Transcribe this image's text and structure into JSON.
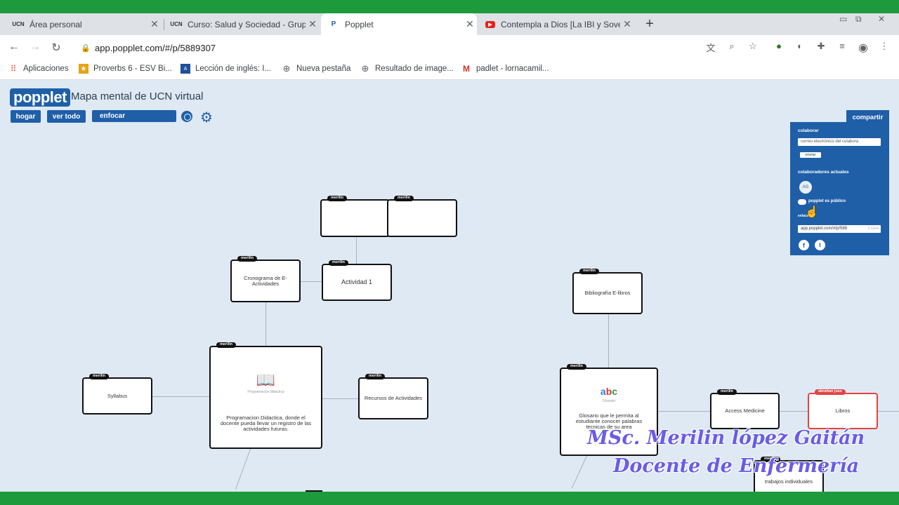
{
  "browser": {
    "tabs": [
      {
        "title": "Área personal",
        "favicon": "UCN"
      },
      {
        "title": "Curso: Salud y Sociedad - Grupo",
        "favicon": "UCN"
      },
      {
        "title": "Popplet",
        "favicon": "P"
      },
      {
        "title": "Contempla a Dios [La IBI y Soven",
        "favicon": "▶"
      }
    ],
    "url": "app.popplet.com/#/p/5889307",
    "bookmarks": [
      {
        "label": "Aplicaciones"
      },
      {
        "label": "Proverbs 6 - ESV Bi..."
      },
      {
        "label": "Lección de inglés: I..."
      },
      {
        "label": "Nueva pestaña"
      },
      {
        "label": "Resultado de image..."
      },
      {
        "label": "padlet - lornacamil..."
      }
    ]
  },
  "app": {
    "logo": "popplet",
    "title": "Mapa mental de UCN virtual",
    "buttons": {
      "home": "hogar",
      "view_all": "ver todo",
      "focus": "enfocar"
    }
  },
  "share": {
    "button": "compartir",
    "collaborate_label": "colaborar",
    "email_placeholder": "correo electrónico del colabora",
    "send": "enviar",
    "current_label": "colaboradores actuales",
    "avatar": "AG",
    "public_label": "popplet es público",
    "link_label": "enlace",
    "link": "app.popplet.com/#/p/588",
    "copy": "Copiar"
  },
  "popples": {
    "author": "merilin",
    "author_red": "abrahan jose",
    "actividad1": "Actividad 1",
    "cronograma": "Cronograma de E-Actividades",
    "programacion_caption": "Programación didáctica",
    "programacion": "Programacion Didactica, donde el docente pueda llevar un registro de las actividades futuras.",
    "syllabus": "Syllabus",
    "recursos": "Recursos de Actividades",
    "bibliografia": "Bibliografía E-libros",
    "glosario_caption": "Glosario",
    "glosario": "Glosario que le permita al estudiante conocer palabras tecnicas de su area",
    "access": "Access Medicine",
    "libros": "Libros",
    "trabajos": "trabajos individuales"
  },
  "watermark": {
    "line1": "MSc. Merilin lópez Gaitán",
    "line2": "Docente de Enfermería"
  }
}
